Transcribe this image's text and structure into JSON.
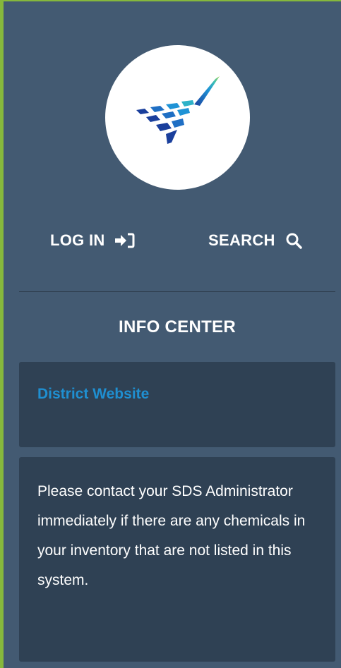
{
  "logo": {
    "icon": "checkmark-logo-icon"
  },
  "nav": {
    "login_label": "LOG IN",
    "login_icon": "sign-in-icon",
    "search_label": "SEARCH",
    "search_icon": "search-icon"
  },
  "info_center": {
    "title": "INFO CENTER",
    "link_label": "District Website",
    "notice": "Please contact your SDS Administrator immediately if there are any chemicals in your inventory that are not listed in this system."
  },
  "colors": {
    "panel_bg": "#435a72",
    "card_bg": "#2f4154",
    "link": "#1f8fd1",
    "accent_border": "#86b83c"
  }
}
